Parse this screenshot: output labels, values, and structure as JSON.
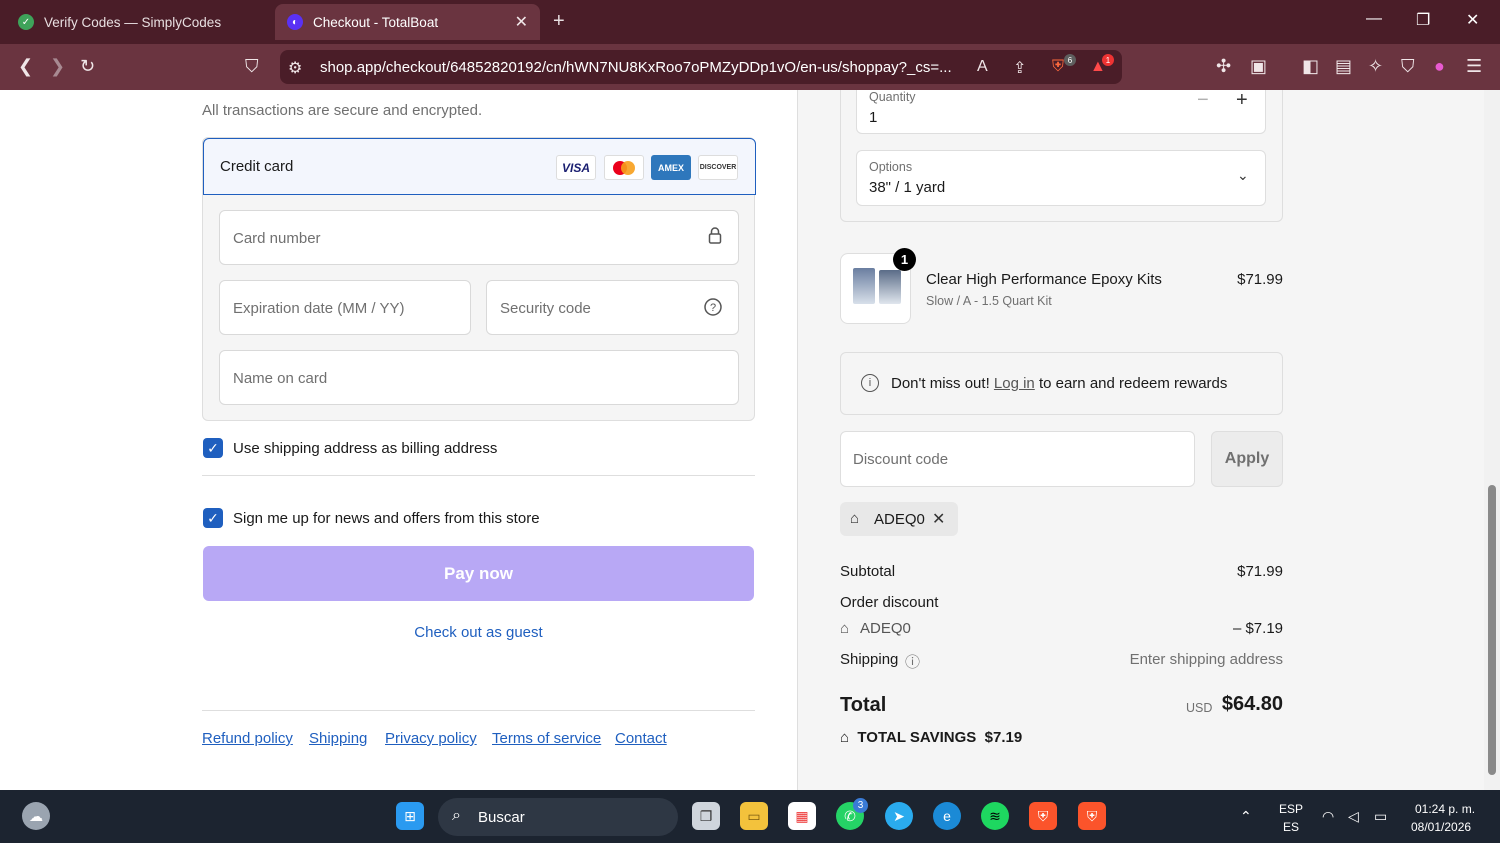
{
  "browser": {
    "tabs": [
      {
        "title": "Verify Codes — SimplyCodes",
        "active": false
      },
      {
        "title": "Checkout - TotalBoat",
        "active": true
      }
    ],
    "url": "shop.app/checkout/64852820192/cn/hWN7NU8KxRoo7oPMZyDDp1vO/en-us/shoppay?_cs=...",
    "shield_count": "6",
    "rewards_count": "1"
  },
  "payment": {
    "secure_note": "All transactions are secure and encrypted.",
    "method_label": "Credit card",
    "brands": [
      "VISA",
      "",
      "AMEX",
      "DISCOVER"
    ],
    "card_number_placeholder": "Card number",
    "expiry_placeholder": "Expiration date (MM / YY)",
    "cvv_placeholder": "Security code",
    "name_placeholder": "Name on card",
    "billing_checkbox_label": "Use shipping address as billing address",
    "newsletter_checkbox_label": "Sign me up for news and offers from this store",
    "pay_button": "Pay now",
    "guest_link": "Check out as guest"
  },
  "footer_links": [
    "Refund policy",
    "Shipping",
    "Privacy policy",
    "Terms of service",
    "Contact"
  ],
  "summary": {
    "quantity_label": "Quantity",
    "quantity_value": "1",
    "options_label": "Options",
    "options_value": "38\" / 1 yard",
    "product": {
      "name": "Clear High Performance Epoxy Kits",
      "variant": "Slow / A - 1.5 Quart Kit",
      "price": "$71.99",
      "qty_badge": "1"
    },
    "rewards": {
      "pre": "Don't miss out! ",
      "link": "Log in",
      "post": " to earn and redeem rewards"
    },
    "discount_placeholder": "Discount code",
    "apply_button": "Apply",
    "applied_code": "ADEQ0",
    "subtotal_label": "Subtotal",
    "subtotal_value": "$71.99",
    "order_discount_label": "Order discount",
    "discount_code_line": "ADEQ0",
    "discount_value": "– $7.19",
    "shipping_label": "Shipping",
    "shipping_value": "Enter shipping address",
    "total_label": "Total",
    "total_currency": "USD",
    "total_value": "$64.80",
    "savings_label": "TOTAL SAVINGS",
    "savings_value": "$7.19"
  },
  "taskbar": {
    "search_text": "Buscar",
    "lang_top": "ESP",
    "lang_bottom": "ES",
    "time": "01:24 p. m.",
    "date": "08/01/2026",
    "whatsapp_badge": "3"
  }
}
